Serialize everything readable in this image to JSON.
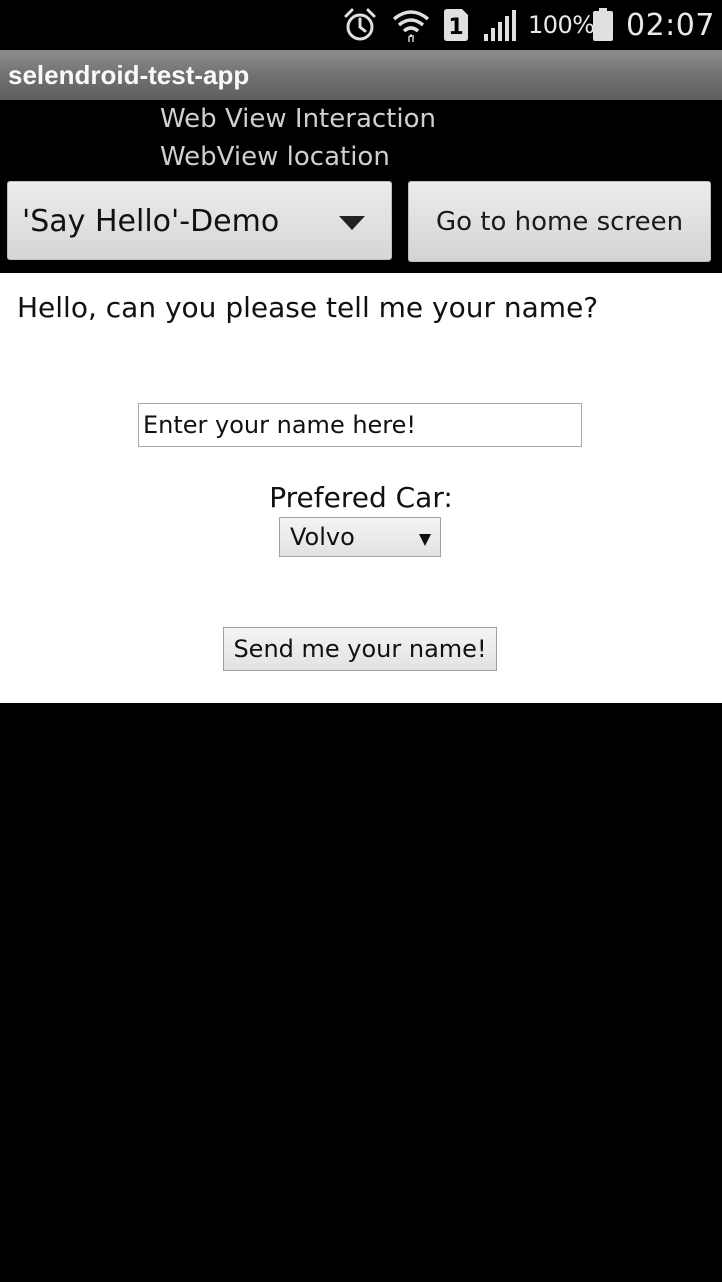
{
  "status_bar": {
    "icons": [
      "alarm-icon",
      "wifi-icon",
      "sim-1-icon",
      "signal-icon",
      "battery-icon"
    ],
    "sim_slot": "1",
    "battery_percent": "100%",
    "time": "02:07"
  },
  "app": {
    "title": "selendroid-test-app"
  },
  "labels": {
    "line1": "Web View Interaction",
    "line2": "WebView location"
  },
  "controls": {
    "spinner_value": "'Say Hello'-Demo",
    "home_button_label": "Go to home screen"
  },
  "webview": {
    "question": "Hello, can you please tell me your name?",
    "name_input_value": "Enter your name here!",
    "car_label": "Prefered Car:",
    "car_selected": "Volvo",
    "send_button_label": "Send me your name!"
  },
  "colors": {
    "screen_background": "#000000",
    "title_bar": "#7a7a7a",
    "webview_background": "#ffffff",
    "button_face": "#e0e0e0"
  }
}
